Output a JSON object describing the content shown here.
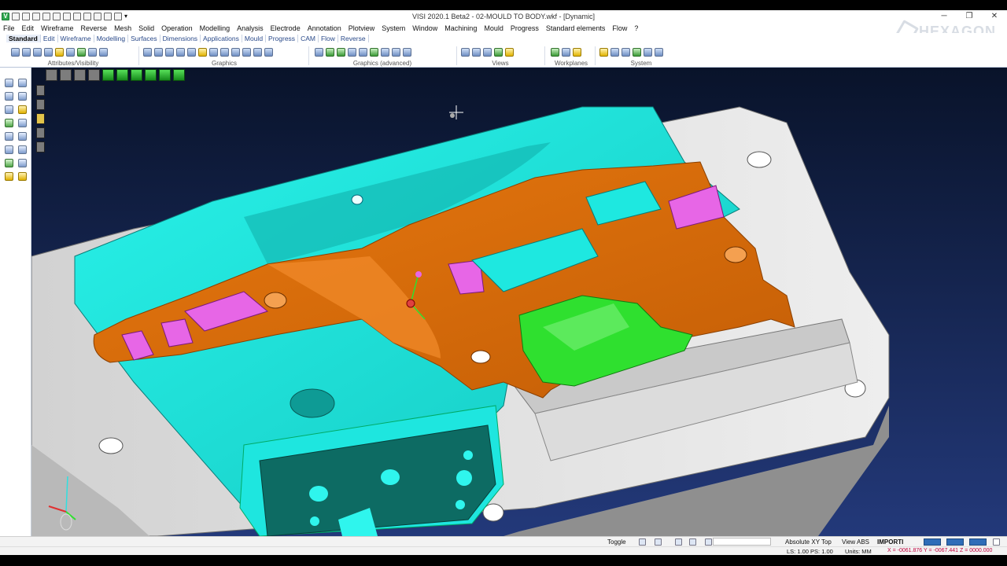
{
  "window": {
    "title": "VISI 2020.1 Beta2 - 02-MOULD TO BODY.wkf - [Dynamic]",
    "controls": {
      "minimize": "─",
      "restore": "❐",
      "close": "✕"
    }
  },
  "quick_access": {
    "app_icon": "V",
    "icons": [
      "new-file-icon",
      "open-folder-icon",
      "open-icon",
      "save-icon",
      "save-all-icon",
      "print-icon",
      "print-preview-icon",
      "zoom-icon",
      "undo-icon",
      "redo-icon",
      "redo-history-icon",
      "dropdown-icon"
    ]
  },
  "menu": [
    "File",
    "Edit",
    "Wireframe",
    "Reverse",
    "Mesh",
    "Solid",
    "Operation",
    "Modelling",
    "Analysis",
    "Electrode",
    "Annotation",
    "Plotview",
    "System",
    "Window",
    "Machining",
    "Mould",
    "Progress",
    "Standard elements",
    "Flow",
    "?"
  ],
  "tabs": [
    {
      "label": "Standard",
      "active": true
    },
    {
      "label": "Edit"
    },
    {
      "label": "Wireframe"
    },
    {
      "label": "Modelling"
    },
    {
      "label": "Surfaces"
    },
    {
      "label": "Dimensions"
    },
    {
      "label": "Applications"
    },
    {
      "label": "Mould"
    },
    {
      "label": "Progress"
    },
    {
      "label": "CAM"
    },
    {
      "label": "Flow"
    },
    {
      "label": "Reverse"
    }
  ],
  "ribbon": {
    "groups": [
      {
        "label": "Attributes/Visibility",
        "icon_count": 9
      },
      {
        "label": "Graphics",
        "icon_count": 12
      },
      {
        "label": "Graphics (advanced)",
        "icon_count": 9
      },
      {
        "label": "Views",
        "icon_count": 5
      },
      {
        "label": "Workplanes",
        "icon_count": 3
      },
      {
        "label": "System",
        "icon_count": 6
      }
    ]
  },
  "brand": {
    "name": "HEXAGON"
  },
  "statusbar": {
    "toggle": "Toggle",
    "view_plane": "Absolute XY Top",
    "view": "View ABS",
    "mode": "IMPORTI",
    "scale": "LS: 1.00 PS: 1.00",
    "units": "Units: MM",
    "coords": "X = -0061.876 Y = -0067.441 Z = 0000.000"
  },
  "colors": {
    "background": "#0c1730",
    "cyan_part": "#1ee8e0",
    "orange_part": "#dc6d0c",
    "magenta_inserts": "#e766e6",
    "green_insert": "#2fe02f",
    "grey_plate": "#d8d8d8",
    "dark_teal": "#0d6b63"
  }
}
